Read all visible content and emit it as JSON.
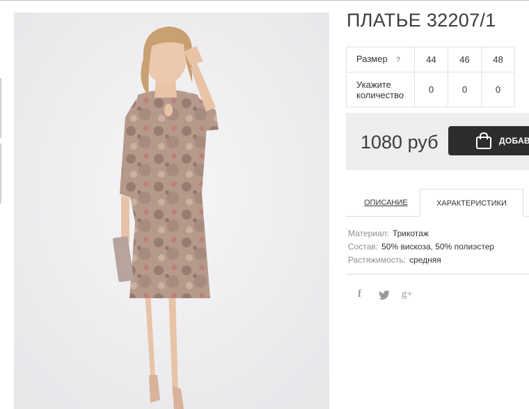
{
  "product": {
    "title": "ПЛАТЬЕ 32207/1",
    "image_alt": "dress-photo"
  },
  "size_table": {
    "size_label": "Размер",
    "help_glyph": "?",
    "sizes": [
      "44",
      "46",
      "48"
    ],
    "quantity_label_line1": "Укажите",
    "quantity_label_line2": "количество",
    "quantities": [
      "0",
      "0",
      "0"
    ]
  },
  "purchase": {
    "price": "1080 руб",
    "add_label": "ДОБАВИТЬ",
    "bag_icon": "shopping-bag-icon"
  },
  "tabs": {
    "description": "ОПИСАНИЕ",
    "characteristics": "ХАРАКТЕРИСТИКИ",
    "active": "characteristics"
  },
  "specs": [
    {
      "key": "Материал:",
      "value": "Трикотаж"
    },
    {
      "key": "Состав:",
      "value": "50% вискоза, 50% полиэстер"
    },
    {
      "key": "Растяжимость:",
      "value": "средняя"
    }
  ],
  "social": {
    "facebook_glyph": "f",
    "twitter_icon": "twitter-icon",
    "gplus_glyph": "g+"
  },
  "colors": {
    "button_bg": "#2d2d2d",
    "price_panel_bg": "#eeeeee",
    "photo_bg": "#efeff1"
  }
}
